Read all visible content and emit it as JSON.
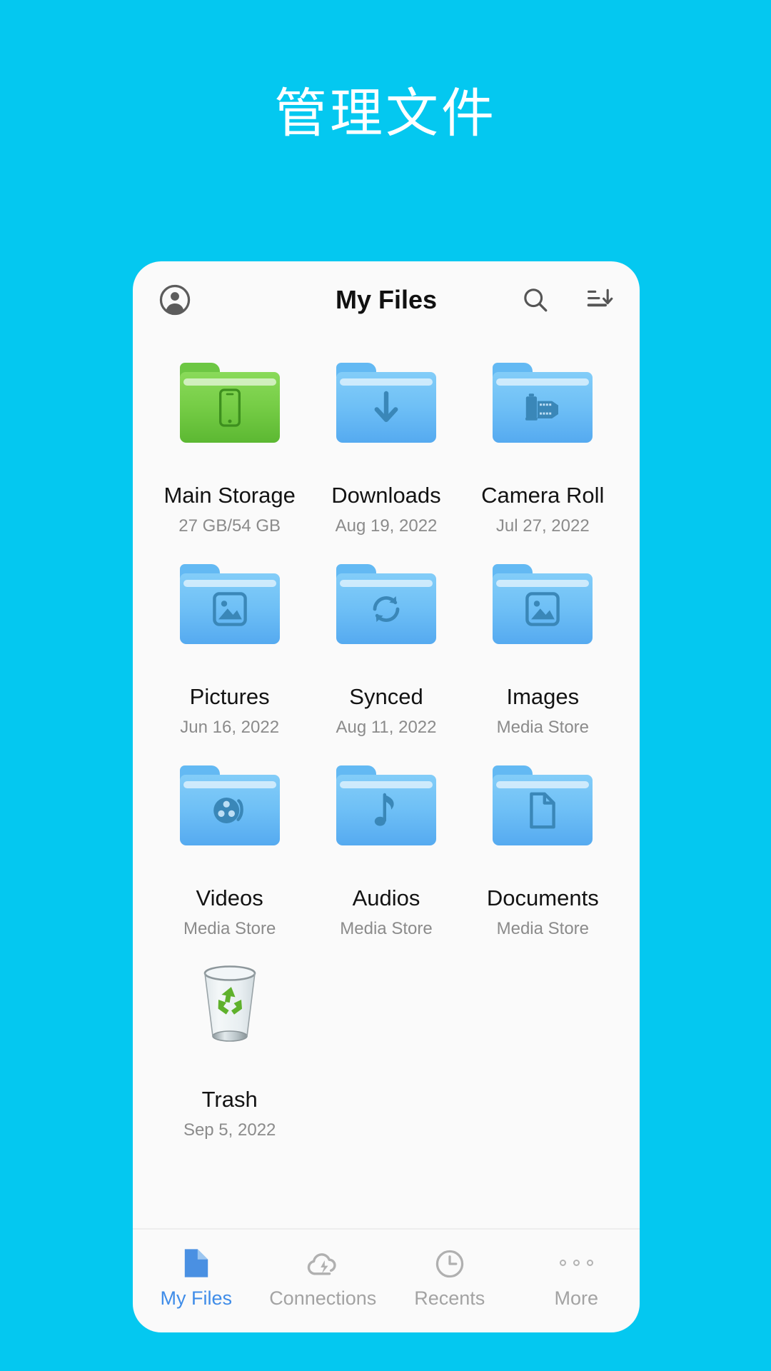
{
  "promo": {
    "title": "管理文件"
  },
  "colors": {
    "background": "#04c8f0",
    "card": "#fafafa",
    "accent": "#3f8ce8",
    "folder_blue": "#6fc0f6",
    "folder_green": "#76cd46",
    "title_text": "#ffffff"
  },
  "app": {
    "header": {
      "title": "My Files",
      "account_icon": "account-circle-icon",
      "search_icon": "search-icon",
      "sort_icon": "sort-descending-icon"
    },
    "items": [
      {
        "name": "Main Storage",
        "sub": "27 GB/54 GB",
        "icon": "folder-phone-icon",
        "color": "green"
      },
      {
        "name": "Downloads",
        "sub": "Aug 19, 2022",
        "icon": "folder-download-icon",
        "color": "blue"
      },
      {
        "name": "Camera Roll",
        "sub": "Jul 27, 2022",
        "icon": "folder-camera-roll-icon",
        "color": "blue"
      },
      {
        "name": "Pictures",
        "sub": "Jun 16, 2022",
        "icon": "folder-image-icon",
        "color": "blue"
      },
      {
        "name": "Synced",
        "sub": "Aug 11, 2022",
        "icon": "folder-sync-icon",
        "color": "blue"
      },
      {
        "name": "Images",
        "sub": "Media Store",
        "icon": "folder-image-icon",
        "color": "blue"
      },
      {
        "name": "Videos",
        "sub": "Media Store",
        "icon": "folder-film-reel-icon",
        "color": "blue"
      },
      {
        "name": "Audios",
        "sub": "Media Store",
        "icon": "folder-music-note-icon",
        "color": "blue"
      },
      {
        "name": "Documents",
        "sub": "Media Store",
        "icon": "folder-document-icon",
        "color": "blue"
      },
      {
        "name": "Trash",
        "sub": "Sep 5, 2022",
        "icon": "trash-recycle-bin-icon",
        "color": "trash"
      }
    ],
    "bottom_nav": [
      {
        "label": "My Files",
        "icon": "file-icon",
        "active": true
      },
      {
        "label": "Connections",
        "icon": "cloud-bolt-icon",
        "active": false
      },
      {
        "label": "Recents",
        "icon": "clock-icon",
        "active": false
      },
      {
        "label": "More",
        "icon": "more-dots-icon",
        "active": false
      }
    ]
  }
}
